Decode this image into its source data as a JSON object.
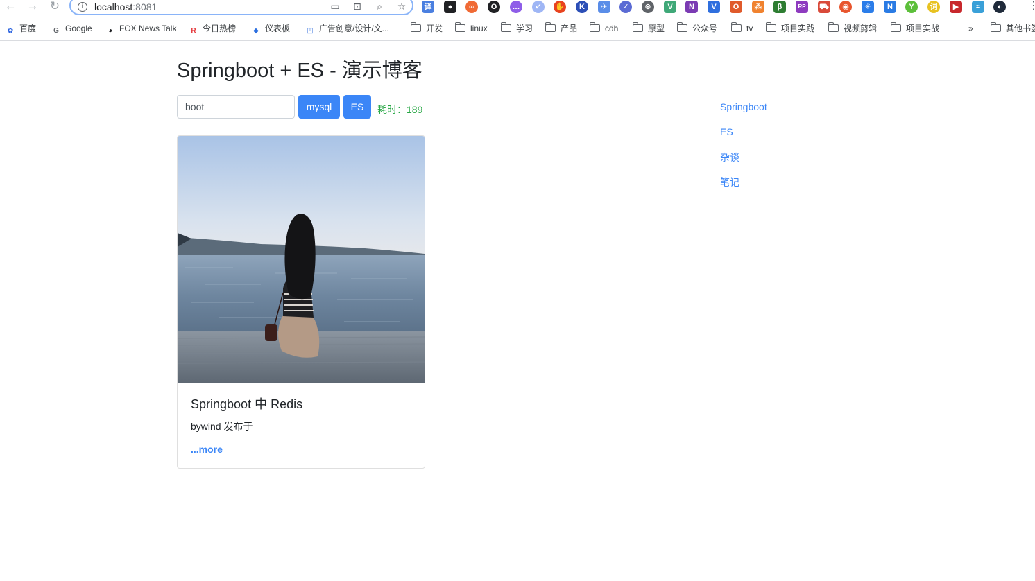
{
  "browser": {
    "url_host": "localhost",
    "url_port": ":8081",
    "extensions": [
      {
        "name": "translate-icon",
        "color": "#4a7fe0",
        "glyph": "译",
        "round": false
      },
      {
        "name": "ghost-extension-icon",
        "color": "#202124",
        "glyph": "●",
        "round": false
      },
      {
        "name": "infinity-extension-icon",
        "color": "#f06a35",
        "glyph": "∞",
        "round": true
      },
      {
        "name": "ring-extension-icon",
        "color": "#202124",
        "glyph": "O",
        "round": true
      },
      {
        "name": "dots-extension-icon",
        "color": "#8e5de8",
        "glyph": "…",
        "round": true
      },
      {
        "name": "arrow-extension-icon",
        "color": "#9fb6f5",
        "glyph": "↙",
        "round": true
      },
      {
        "name": "adblock-extension-icon",
        "color": "#e8431f",
        "glyph": "✋",
        "round": true
      },
      {
        "name": "k-extension-icon",
        "color": "#2b4eb6",
        "glyph": "K",
        "round": true
      },
      {
        "name": "bird-extension-icon",
        "color": "#5a8de8",
        "glyph": "✈",
        "round": false
      },
      {
        "name": "check-extension-icon",
        "color": "#5b6bd4",
        "glyph": "✓",
        "round": true
      },
      {
        "name": "code-extension-icon",
        "color": "#5f6368",
        "glyph": "⊙",
        "round": true
      },
      {
        "name": "vue-extension-icon",
        "color": "#3fa878",
        "glyph": "V",
        "round": false
      },
      {
        "name": "onenote-extension-icon",
        "color": "#7b3bb3",
        "glyph": "N",
        "round": false
      },
      {
        "name": "v-extension-icon",
        "color": "#2f6fde",
        "glyph": "V",
        "round": false
      },
      {
        "name": "office-extension-icon",
        "color": "#e05a2b",
        "glyph": "O",
        "round": false
      },
      {
        "name": "network-extension-icon",
        "color": "#f0822f",
        "glyph": "⁂",
        "round": false
      },
      {
        "name": "b-extension-icon",
        "color": "#2e7d32",
        "glyph": "β",
        "round": false
      },
      {
        "name": "rp-extension-icon",
        "color": "#8e3bbf",
        "glyph": "RP",
        "round": false
      },
      {
        "name": "car-extension-icon",
        "color": "#d94a3a",
        "glyph": "⛟",
        "round": false
      },
      {
        "name": "weibo-extension-icon",
        "color": "#e8552d",
        "glyph": "◉",
        "round": true
      },
      {
        "name": "star-extension-icon",
        "color": "#2b7de9",
        "glyph": "✳",
        "round": false
      },
      {
        "name": "new-extension-icon",
        "color": "#2a7be4",
        "glyph": "N",
        "round": false
      },
      {
        "name": "y-extension-icon",
        "color": "#5cbf3a",
        "glyph": "Y",
        "round": true
      },
      {
        "name": "dict-extension-icon",
        "color": "#e8c221",
        "glyph": "词",
        "round": true
      },
      {
        "name": "video-extension-icon",
        "color": "#c8282c",
        "glyph": "▶",
        "round": false
      },
      {
        "name": "chart-extension-icon",
        "color": "#3aa0d8",
        "glyph": "≈",
        "round": false
      },
      {
        "name": "profile-avatar-icon",
        "color": "#1f2a3a",
        "glyph": "◐",
        "round": true
      }
    ]
  },
  "bookmarks": {
    "items": [
      {
        "label": "百度",
        "icon": "baidu-icon",
        "color": "#2d64e0"
      },
      {
        "label": "Google",
        "icon": "google-icon",
        "color": "#5f6368"
      },
      {
        "label": "FOX News Talk",
        "icon": "globe-icon",
        "color": "#202124"
      },
      {
        "label": "今日热榜",
        "icon": "r-icon",
        "color": "#e5383b"
      },
      {
        "label": "仪表板",
        "icon": "diamond-icon",
        "color": "#2b6fe0"
      },
      {
        "label": "广告创意/设计/文...",
        "icon": "square-icon",
        "color": "#4a7fe0"
      }
    ],
    "folders": [
      "开发",
      "linux",
      "学习",
      "产品",
      "cdh",
      "原型",
      "公众号",
      "tv",
      "项目实践",
      "视频剪辑",
      "项目实战"
    ],
    "overflow": "»",
    "other_folder": "其他书签"
  },
  "header": {
    "title": "Springboot + ES - 演示博客"
  },
  "search": {
    "value": "boot",
    "mysql_label": "mysql",
    "es_label": "ES",
    "elapsed_label": "耗时：",
    "elapsed_value": "189"
  },
  "posts": [
    {
      "title": "Springboot 中 Redis",
      "author": "bywind",
      "published_suffix": "发布于",
      "more_label": "...more"
    }
  ],
  "categories": [
    "Springboot",
    "ES",
    "杂谈",
    "笔记"
  ]
}
